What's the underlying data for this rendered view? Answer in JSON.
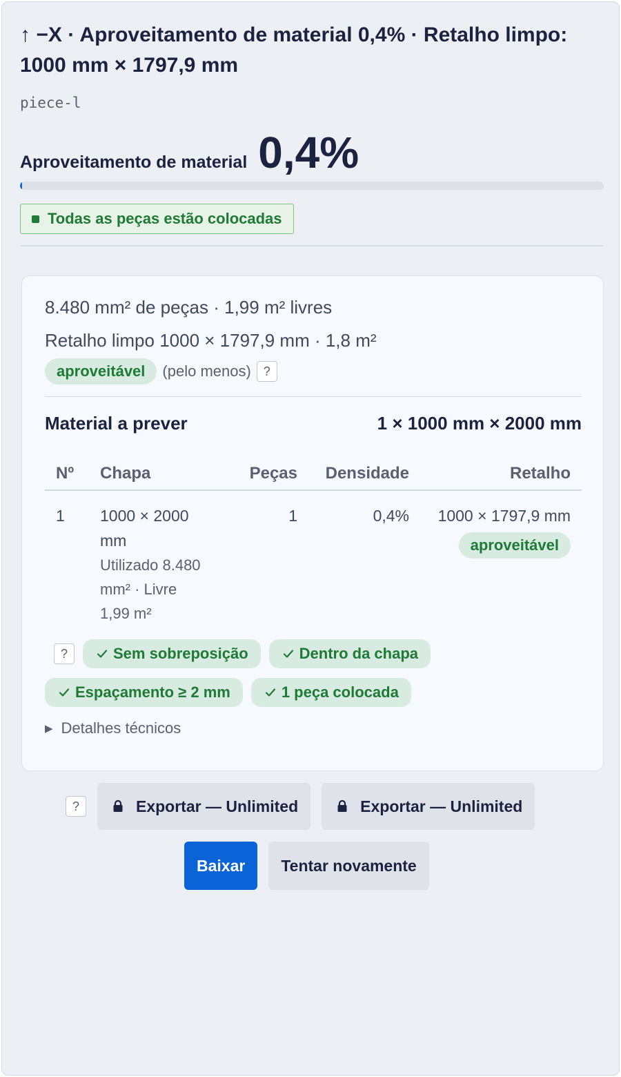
{
  "header": {
    "title": "↑ −X · Aproveitamento de material 0,4% · Retalho limpo: 1000 mm × 1797,9 mm",
    "piece_id": "piece-l"
  },
  "utilization": {
    "label": "Aproveitamento de material",
    "value": "0,4%",
    "fraction": 0.004
  },
  "status": {
    "label": "Todas as peças estão colocadas"
  },
  "summary": {
    "area_stats": "8.480 mm² de peças · 1,99 m² livres",
    "remnant": "Retalho limpo 1000 × 1797,9 mm · 1,8 m²",
    "reusable_badge": "aproveitável",
    "qualifier": "(pelo menos)",
    "help": "?"
  },
  "material": {
    "label": "Material a prever",
    "value": "1 × 1000 mm × 2000 mm"
  },
  "table": {
    "headers": {
      "no": "Nº",
      "sheet": "Chapa",
      "pieces": "Peças",
      "density": "Densidade",
      "remnant": "Retalho"
    },
    "rows": [
      {
        "no": "1",
        "sheet": "1000 × 2000 mm",
        "used": "Utilizado 8.480 mm² · Livre 1,99 m²",
        "pieces": "1",
        "density": "0,4%",
        "remnant": "1000 × 1797,9 mm",
        "remnant_badge": "aproveitável"
      }
    ]
  },
  "checks": {
    "help": "?",
    "items": [
      "Sem sobreposição",
      "Dentro da chapa",
      "Espaçamento ≥ 2 mm",
      "1 peça colocada"
    ]
  },
  "details": {
    "label": "Detalhes técnicos"
  },
  "exports": {
    "help": "?",
    "buttons": [
      "Exportar — Unlimited",
      "Exportar — Unlimited"
    ]
  },
  "actions": {
    "download": "Baixar",
    "retry": "Tentar novamente"
  },
  "colors": {
    "accent": "#0b63d8",
    "success": "#1e7a34",
    "success_bg": "#d8ebe1"
  }
}
